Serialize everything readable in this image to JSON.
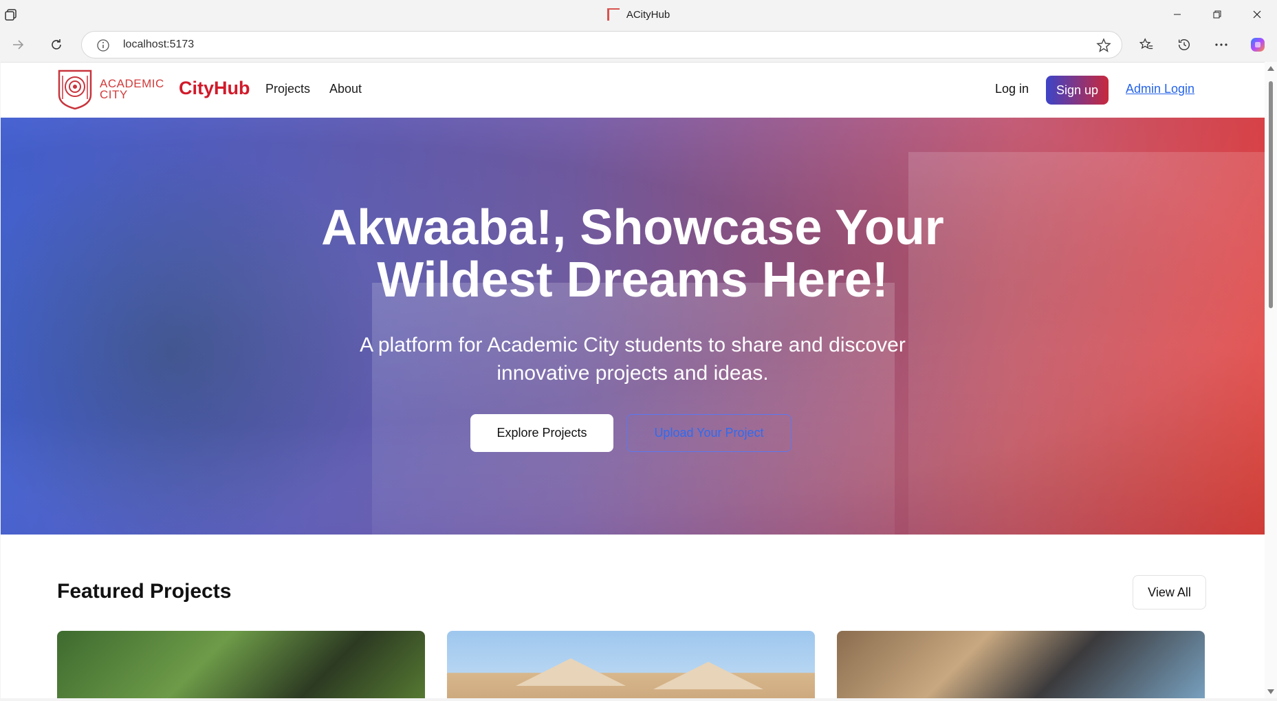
{
  "browser": {
    "tab_title": "ACityHub",
    "url": "localhost:5173"
  },
  "header": {
    "logo_line1": "ACADEMIC",
    "logo_line2": "CITY",
    "brand": "CityHub",
    "nav": {
      "projects": "Projects",
      "about": "About"
    },
    "login": "Log in",
    "signup": "Sign up",
    "admin_login": "Admin Login"
  },
  "hero": {
    "title_line1": "Akwaaba!, Showcase Your",
    "title_line2": "Wildest Dreams Here!",
    "subtitle_line1": "A platform for Academic City students to share and discover",
    "subtitle_line2": "innovative projects and ideas.",
    "explore_button": "Explore Projects",
    "upload_button": "Upload Your Project"
  },
  "featured": {
    "title": "Featured Projects",
    "view_all": "View All"
  },
  "colors": {
    "brand_red": "#d11a2a",
    "link_blue": "#2463eb",
    "gradient_start": "#3d44c8",
    "gradient_end": "#c8283c"
  }
}
